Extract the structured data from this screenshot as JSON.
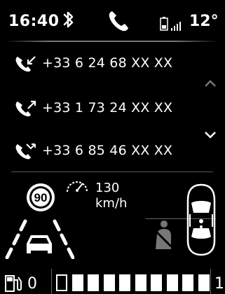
{
  "status_bar": {
    "time": "16:40",
    "temperature": "12°",
    "icons": [
      "bluetooth-icon",
      "phone-icon",
      "battery-icon",
      "signal-icon"
    ]
  },
  "calls": [
    {
      "direction": "incoming",
      "number": "+33 6 24 68 XX XX"
    },
    {
      "direction": "outgoing",
      "number": "+33 1 73 24 XX XX"
    },
    {
      "direction": "missed",
      "number": "+33 6 85 46 XX XX"
    }
  ],
  "driving": {
    "speed_limit": "90",
    "speed_value": "130",
    "speed_unit": "km/h"
  },
  "fuel": {
    "min_label": "0",
    "max_label": "1",
    "segments_total": 10,
    "segments_filled": 9
  },
  "colors": {
    "background": "#000000",
    "foreground": "#ffffff",
    "speed_sign_ring": "#ffffff",
    "divider": "#666666"
  }
}
